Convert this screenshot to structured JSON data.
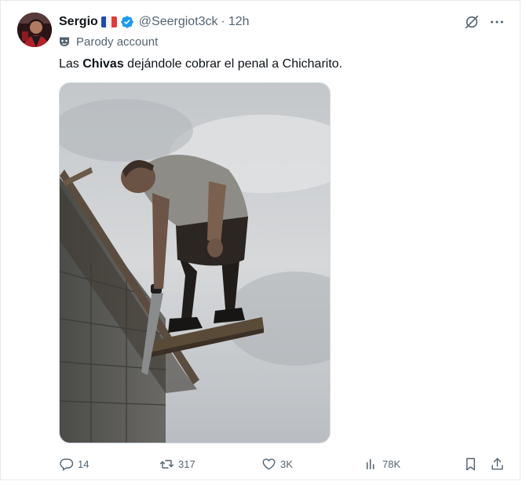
{
  "author": {
    "display_name": "Sergio",
    "flag_icon": "france-flag-icon",
    "verified_icon": "verified-badge-icon",
    "handle": "@Seergiot3ck",
    "separator": "·",
    "time": "12h",
    "label": "Parody account"
  },
  "tweet": {
    "text_before": "Las ",
    "text_bold": "Chivas",
    "text_after": " dejándole cobrar el penal a Chicharito."
  },
  "top_actions": [
    "grok-icon",
    "more-icon"
  ],
  "actions": {
    "replies": "14",
    "retweets": "317",
    "likes": "3K",
    "views": "78K"
  },
  "colors": {
    "text": "#0f1419",
    "secondary": "#536471",
    "verified": "#1d9bf0",
    "border": "#e7e9ea"
  }
}
